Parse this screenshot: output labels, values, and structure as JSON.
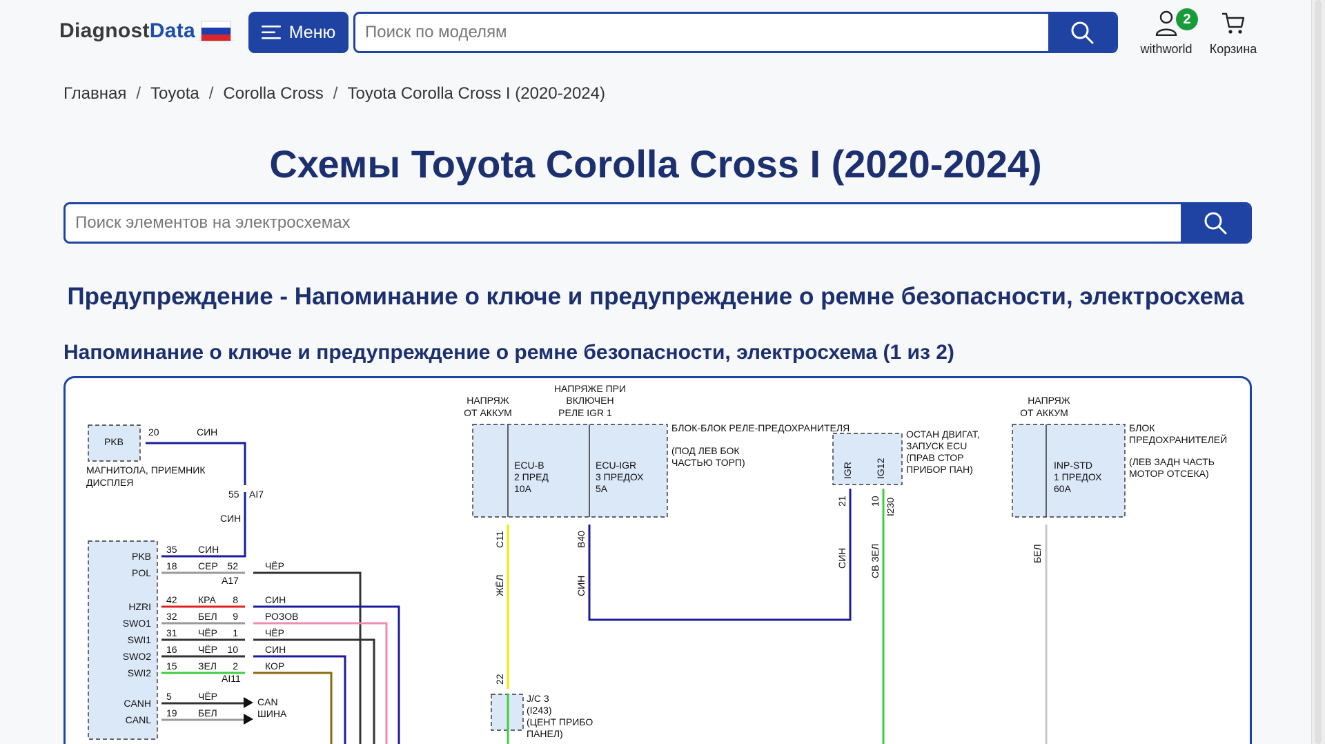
{
  "header": {
    "logo_part1": "Diagnost",
    "logo_part2": "Data",
    "menu_label": "Меню",
    "search_placeholder": "Поиск по моделям",
    "user_label": "withworld",
    "user_badge": "2",
    "cart_label": "Корзина"
  },
  "breadcrumb": {
    "items": [
      "Главная",
      "Toyota",
      "Corolla Cross",
      "Toyota Corolla Cross I (2020-2024)"
    ],
    "separator": "/"
  },
  "page_title": "Схемы Toyota Corolla Cross I (2020-2024)",
  "element_search_placeholder": "Поиск элементов на электросхемах",
  "section_title": "Предупреждение - Напоминание о ключе и предупреждение о ремне безопасности, электросхема",
  "diagram_title": "Напоминание о ключе и предупреждение о ремне безопасности, электросхема (1 из 2)",
  "diagram": {
    "pkb_box": "PKB",
    "radio_label_1": "МАГНИТОЛА, ПРИЕМНИК",
    "radio_label_2": "ДИСПЛЕЯ",
    "pin20": "20",
    "sin": "СИН",
    "pin55": "55",
    "ai7": "AI7",
    "pins_left": [
      "PKB",
      "POL",
      "HZRI",
      "SWO1",
      "SWI1",
      "SWO2",
      "SWI2",
      "CANH",
      "CANL"
    ],
    "pin_nums_left": [
      "35",
      "18",
      "42",
      "32",
      "31",
      "16",
      "15",
      "5",
      "19"
    ],
    "wire_colors_left": [
      "СИН",
      "СЕР",
      "КРА",
      "БЕЛ",
      "ЧЁР",
      "ЧЁР",
      "ЗЕЛ",
      "ЧЁР",
      "БЕЛ"
    ],
    "mid_pins": [
      "52",
      "8",
      "9",
      "1",
      "10",
      "2"
    ],
    "mid_colors": [
      "ЧЁР",
      "СИН",
      "РОЗОВ",
      "ЧЁР",
      "СИН",
      "КОР"
    ],
    "a17": "A17",
    "ai11": "AI11",
    "can_bus_1": "CAN",
    "can_bus_2": "ШИНА",
    "napr_akkum_1": "НАПРЯЖ",
    "napr_akkum_2": "ОТ АККУМ",
    "napr_igr_1": "НАПРЯЖЕ ПРИ",
    "napr_igr_2": "ВКЛЮЧЕН",
    "napr_igr_3": "РЕЛЕ IGR 1",
    "relay_block_1": "БЛОК-БЛОК РЕЛЕ-ПРЕДОХРАНИТЕЛЯ",
    "relay_block_2": "(ПОД ЛЕВ БОК",
    "relay_block_3": "ЧАСТЬЮ ТОРП)",
    "ecub_1": "ECU-B",
    "ecub_2": "2 ПРЕД",
    "ecub_3": "10A",
    "ecuigr_1": "ECU-IGR",
    "ecuigr_2": "3 ПРЕДОХ",
    "ecuigr_3": "5A",
    "c11": "C11",
    "b40": "B40",
    "zhel": "ЖЁЛ",
    "pin22": "22",
    "jc3_1": "J/C 3",
    "jc3_2": "(I243)",
    "jc3_3": "(ЦЕНТ ПРИБО",
    "jc3_4": "ПАНЕЛ)",
    "ecu_stop_1": "ОСТАН ДВИГАТ,",
    "ecu_stop_2": "ЗАПУСК ECU",
    "ecu_stop_3": "(ПРАВ СТОР",
    "ecu_stop_4": "ПРИБОР ПАН)",
    "igr": "IGR",
    "ig12": "IG12",
    "pin21": "21",
    "pin10": "10",
    "i230": "I230",
    "sv_zel": "СВ ЗЕЛ",
    "fuse_block_1": "БЛОК",
    "fuse_block_2": "ПРЕДОХРАНИТЕЛЕЙ",
    "fuse_block_3": "(ЛЕВ ЗАДН ЧАСТЬ",
    "fuse_block_4": "МОТОР ОТСЕКА)",
    "inp_1": "INP-STD",
    "inp_2": "1 ПРЕДОХ",
    "inp_3": "60A",
    "bel": "БЕЛ"
  },
  "colors": {
    "brand": "#1f43a3",
    "badge": "#1a9b3b",
    "wire_blue": "#1b1b9e",
    "wire_yellow": "#f2e600",
    "wire_green": "#3ccf3c",
    "wire_red": "#e02020",
    "wire_pink": "#f08bb0",
    "wire_brown": "#8a6a10",
    "wire_gray": "#9a9a9a",
    "wire_black": "#333333",
    "box_fill": "#dbe8f8"
  }
}
